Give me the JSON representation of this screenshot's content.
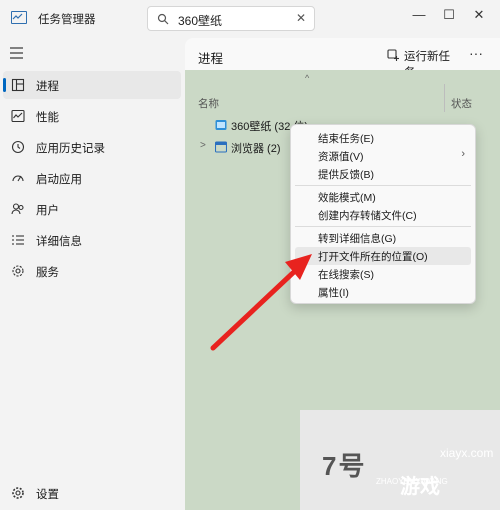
{
  "window": {
    "title": "任务管理器",
    "search_value": "360壁纸",
    "min_glyph": "—",
    "max_glyph": "☐",
    "close_glyph": "✕"
  },
  "sidebar": {
    "items": [
      {
        "label": "进程",
        "icon": "processes-icon",
        "active": true
      },
      {
        "label": "性能",
        "icon": "performance-icon"
      },
      {
        "label": "应用历史记录",
        "icon": "history-icon"
      },
      {
        "label": "启动应用",
        "icon": "startup-icon"
      },
      {
        "label": "用户",
        "icon": "users-icon"
      },
      {
        "label": "详细信息",
        "icon": "details-icon"
      },
      {
        "label": "服务",
        "icon": "services-icon"
      }
    ],
    "settings_label": "设置"
  },
  "main": {
    "title": "进程",
    "run_task_label": "运行新任务",
    "more_glyph": "···",
    "columns": {
      "name": "名称",
      "status": "状态"
    },
    "rows": [
      {
        "label": "360壁纸 (32 位)"
      },
      {
        "label": "浏览器 (2)"
      }
    ]
  },
  "context_menu": {
    "items": [
      "结束任务(E)",
      "资源值(V)",
      "提供反馈(B)",
      "效能模式(M)",
      "创建内存转储文件(C)",
      "转到详细信息(G)",
      "打开文件所在的位置(O)",
      "在线搜索(S)",
      "属性(I)"
    ]
  },
  "watermark": {
    "text": "7号",
    "url": "xiayx.com",
    "sub": "ZHAOYOUXIWANG",
    "logo": "游戏"
  },
  "colors": {
    "accent": "#0067c0",
    "arrow": "#e8231f"
  }
}
